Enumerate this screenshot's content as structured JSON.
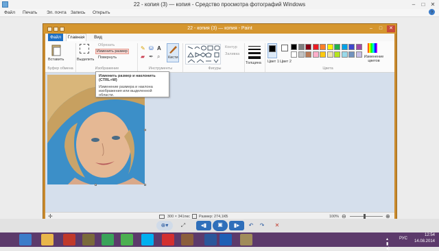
{
  "viewer": {
    "title": "22 - копия (3) — копия - Средство просмотра фотографий Windows",
    "menu": [
      "Файл",
      "Печать",
      "Эл. почта",
      "Запись",
      "Открыть"
    ],
    "help_icon": "?"
  },
  "paint": {
    "title": "22 - копия (3) — копия - Paint",
    "tabs": {
      "file": "Файл",
      "home": "Главная",
      "view": "Вид"
    },
    "clipboard": {
      "paste": "Вставить",
      "group": "Буфер обмена"
    },
    "image": {
      "select": "Выделить",
      "crop": "Обрезать",
      "resize": "Изменить размер",
      "rotate": "Повернуть",
      "group": "Изображение"
    },
    "tools": {
      "group": "Инструменты",
      "brushes": "Кисти"
    },
    "shapes": {
      "outline": "Контур",
      "fill": "Заливка",
      "group": "Фигуры"
    },
    "size": {
      "label": "Толщина"
    },
    "colors": {
      "color1": "Цвет 1",
      "color2": "Цвет 2",
      "edit": "Изменение цветов",
      "group": "Цвета",
      "palette": [
        "#000000",
        "#7f7f7f",
        "#880015",
        "#ed1c24",
        "#ff7f27",
        "#fff200",
        "#22b14c",
        "#00a2e8",
        "#3f48cc",
        "#a349a4",
        "#ffffff",
        "#c3c3c3",
        "#b97a57",
        "#ffaec9",
        "#ffc90e",
        "#efe4b0",
        "#b5e61d",
        "#99d9ea",
        "#7092be",
        "#c8bfe7"
      ]
    },
    "tooltip": {
      "title": "Изменить размер и наклонить (CTRL+W)",
      "text": "Изменение размера и наклона изображения или выделенной области."
    },
    "status": {
      "dimensions": "300 × 341пкс",
      "size": "Размер: 274,1КБ",
      "zoom": "100%"
    }
  },
  "taskbar": {
    "lang": "РУС",
    "time": "12:54",
    "date": "14.08.2014"
  }
}
